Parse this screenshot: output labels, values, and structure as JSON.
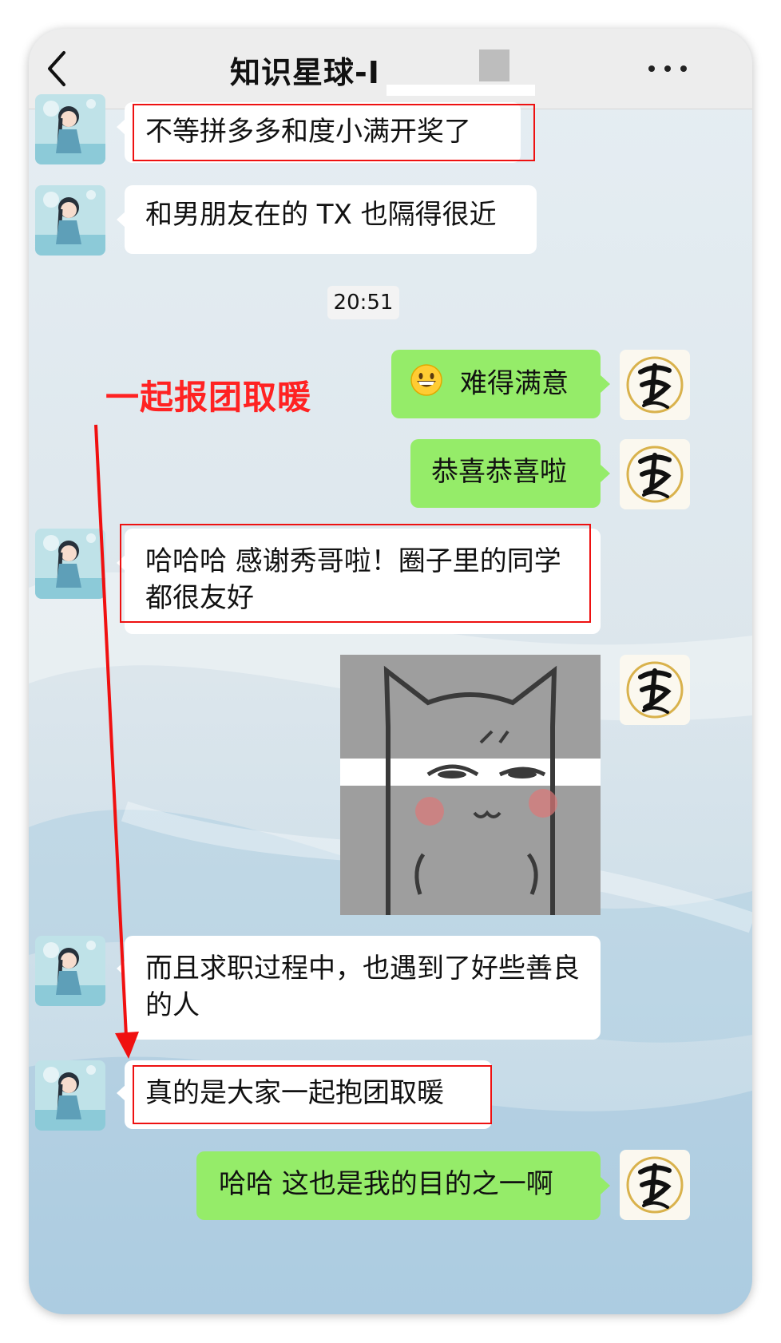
{
  "header": {
    "title": "知识星球-I"
  },
  "annotation": {
    "text": "一起报团取暖"
  },
  "messages": [
    {
      "side": "in",
      "text": "不等拼多多和度小满开奖了",
      "highlighted": true
    },
    {
      "side": "in",
      "text": "和男朋友在的 TX 也隔得很近",
      "highlighted": false
    },
    {
      "side": "out",
      "emoji": "grinning-face",
      "text": "难得满意"
    },
    {
      "side": "out",
      "text": "恭喜恭喜啦"
    },
    {
      "side": "in",
      "text": "哈哈哈 感谢秀哥啦！圈子里的同学都很友好",
      "highlighted": true
    },
    {
      "side": "out",
      "type": "sticker",
      "icon": "cat-smirk-sticker"
    },
    {
      "side": "in",
      "text": "而且求职过程中，也遇到了好些善良的人",
      "highlighted": false
    },
    {
      "side": "in",
      "text": "真的是大家一起抱团取暖",
      "highlighted": true
    },
    {
      "side": "out",
      "text": "哈哈 这也是我的目的之一啊"
    }
  ],
  "timestamp": "20:51",
  "colors": {
    "topbar": "#ededed",
    "bubble_in": "#ffffff",
    "bubble_out": "#95ec69",
    "highlight": "#ee1111"
  },
  "icons": {
    "back": "chevron-left-icon",
    "more": "more-dots-icon",
    "other_avatar": "girl-avatar",
    "self_avatar": "calligraphy-avatar"
  }
}
